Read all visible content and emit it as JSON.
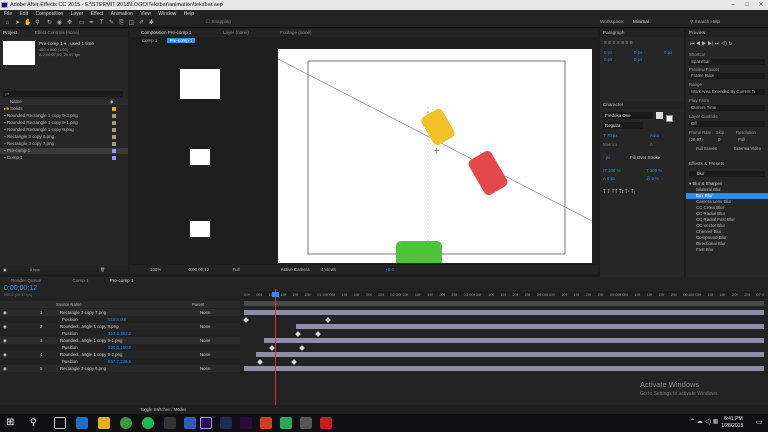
{
  "titlebar": {
    "title": "Adobe After Effects CC 2015 - E:\\STEEMIT 2018\\LOGO\\Teksbar\\animation\\teksbar.aep"
  },
  "menu": [
    "File",
    "Edit",
    "Composition",
    "Layer",
    "Effect",
    "Animation",
    "View",
    "Window",
    "Help"
  ],
  "toolbar": {
    "snapping": "Snapping",
    "workspace_label": "Workspace:",
    "workspace_value": "Minimal",
    "search": "Search Help"
  },
  "project": {
    "tabs": [
      "Project",
      "Effect Controls (none)"
    ],
    "selected_name": "Pre-comp 1 ▾ , used 1 time",
    "selected_meta": [
      "450 x 800 (1.00)",
      "Δ 0;00;07;00, 29.97 fps"
    ],
    "search_placeholder": "ρ▾",
    "col_name": "Name",
    "items": [
      {
        "name": "Solids",
        "type": "folder"
      },
      {
        "name": "Rounded Rectangle 1 copy 9-2.png",
        "type": "png"
      },
      {
        "name": "Rounded Rectangle 1 copy 9-1.png",
        "type": "png"
      },
      {
        "name": "Rounded Rectangle 1 copy 9.png",
        "type": "png"
      },
      {
        "name": "Rectangle 3 copy 6.png",
        "type": "png"
      },
      {
        "name": "Rectangle 3 copy 7.png",
        "type": "png"
      },
      {
        "name": "Pre-comp 1",
        "type": "comp",
        "selected": true
      },
      {
        "name": "Comp 1",
        "type": "comp"
      }
    ],
    "bpc": "8 bpc"
  },
  "comp": {
    "tabs": [
      "Composition Pre-comp 1",
      "Layer (none)",
      "Footage (none)"
    ],
    "breadcrumbs": [
      "Comp 1",
      "Pre-comp 1"
    ],
    "zoom": "100%",
    "timecode": "0;00;00;12",
    "resolution": "Full",
    "camera": "Active Camera",
    "views": "4 Views",
    "exposure": "+0.0"
  },
  "paragraph": {
    "title": "Paragraph",
    "fields": [
      "0 px",
      "0 px",
      "0 px",
      "0 px",
      "0 px"
    ]
  },
  "character": {
    "title": "Character",
    "font": "Fredoka One",
    "style": "Regular",
    "size": "70 px",
    "leading": "Auto",
    "tracking": "Metrics",
    "kern": "0",
    "stroke": "- px",
    "stroke_type": "Fill Over Stroke",
    "vscale": "100 %",
    "hscale": "100 %",
    "baseline": "0 px",
    "tsume": "0 %"
  },
  "preview": {
    "title": "Preview",
    "shortcut_label": "Shortcut",
    "shortcut": "Spacebar",
    "favors_label": "Preview Favors",
    "favors": "Frame Rate",
    "range_label": "Range",
    "range": "Work Area Extended By Current Ti",
    "playfrom_label": "Play From",
    "playfrom": "Current Time",
    "layercontrols_label": "Layer Controls",
    "layercontrols": "Off",
    "framerate_label": "Frame Rate",
    "skip_label": "Skip",
    "resolution_label": "Resolution",
    "framerate": "(29.97)",
    "skip": "0",
    "resolution": "Full",
    "fullscreen": "Full Screen",
    "external": "External Video"
  },
  "effects": {
    "title": "Effects & Presets",
    "search": "blur",
    "group": "Blur & Sharpen",
    "items": [
      "Bilateral Blur",
      "Box Blur",
      "Camera Lens Blur",
      "CC Cross Blur",
      "CC Radial Blur",
      "CC Radial Fast Blur",
      "CC Vector Blur",
      "Channel Blur",
      "Compound Blur",
      "Directional Blur",
      "Fast Blur"
    ],
    "selected": "Box Blur"
  },
  "timeline": {
    "tabs": [
      "Render Queue",
      "Comp 1",
      "Pre-comp 1"
    ],
    "timecode": "0;00;00;12",
    "fps": "00012 (29.97 fps)",
    "col_source": "Source Name",
    "col_parent": "Parent",
    "ticks": [
      "00f",
      "05f",
      "10f",
      "15f",
      "20f",
      "25f",
      "01:00f",
      "05f",
      "10f",
      "15f",
      "20f",
      "25f",
      "02:00f",
      "05f",
      "10f",
      "15f",
      "20f",
      "25f",
      "03:00f",
      "05f",
      "10f",
      "15f",
      "20f",
      "25f",
      "04:00f",
      "05f",
      "10f",
      "15f",
      "20f",
      "25f",
      "05:00f",
      "05f",
      "10f",
      "15f",
      "20f",
      "25f",
      "06:00f",
      "05f",
      "10f",
      "15f",
      "20f",
      "25f",
      "07:0"
    ],
    "layers": [
      {
        "num": "1",
        "name": "Rectangle 3 copy 7.png",
        "parent": "None",
        "prop": "Position",
        "value": "918.8,0.0"
      },
      {
        "num": "2",
        "name": "Rounded...angle 1 copy 9.png",
        "parent": "None",
        "prop": "Position",
        "value": "367.6,382.2"
      },
      {
        "num": "3",
        "name": "Rounded...angle 1 copy 9-1.png",
        "parent": "None",
        "prop": "Position",
        "value": "220.0,150.8"
      },
      {
        "num": "4",
        "name": "Rounded...angle 1 copy 9-2.png",
        "parent": "None",
        "prop": "Position",
        "value": "557.7,226.6"
      },
      {
        "num": "5",
        "name": "Rectangle 3 copy 6.png",
        "parent": "None",
        "prop": "",
        "value": ""
      }
    ],
    "toggle": "Toggle Switches / Modes"
  },
  "watermark": {
    "line1": "Activate Windows",
    "line2": "Go to Settings to activate Windows."
  },
  "taskbar": {
    "time": "6:41 PM",
    "date": "1/28/2018"
  },
  "colors": {
    "accent": "#2d8ceb",
    "ae_purple": "#9999ff",
    "yellow": "#f5c12a",
    "red": "#e5484b",
    "green": "#4fc43a",
    "playhead": "#e03030"
  }
}
